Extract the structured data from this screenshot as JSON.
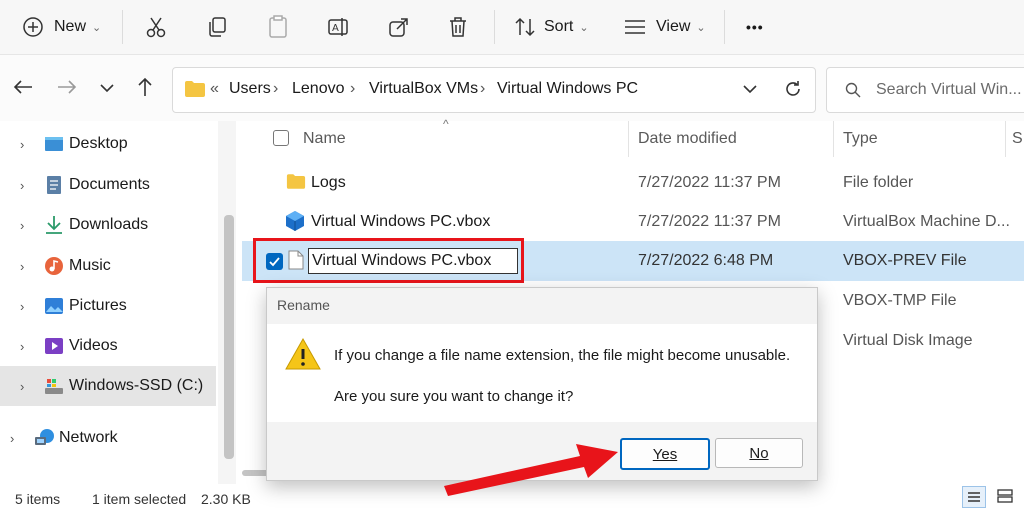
{
  "toolbar": {
    "new_label": "New",
    "sort_label": "Sort",
    "view_label": "View",
    "more_label": "•••",
    "icons": [
      "plus-circle-icon",
      "cut-icon",
      "copy-icon",
      "paste-icon",
      "rename-icon",
      "share-icon",
      "delete-icon",
      "sort-icon",
      "view-icon",
      "more-icon"
    ]
  },
  "nav": {
    "overflow": "«",
    "breadcrumb": [
      "Users",
      "Lenovo",
      "VirtualBox VMs",
      "Virtual Windows PC"
    ],
    "separator": "›",
    "search_placeholder": "Search Virtual Win..."
  },
  "sidebar": {
    "items": [
      {
        "label": "Desktop",
        "icon": "desktop-icon"
      },
      {
        "label": "Documents",
        "icon": "documents-icon"
      },
      {
        "label": "Downloads",
        "icon": "downloads-icon"
      },
      {
        "label": "Music",
        "icon": "music-icon"
      },
      {
        "label": "Pictures",
        "icon": "pictures-icon"
      },
      {
        "label": "Videos",
        "icon": "videos-icon"
      },
      {
        "label": "Windows-SSD (C:)",
        "icon": "drive-icon"
      },
      {
        "label": "Network",
        "icon": "network-icon"
      }
    ]
  },
  "filelist": {
    "columns": {
      "name": "Name",
      "date": "Date modified",
      "type": "Type",
      "size": "S"
    },
    "rows": [
      {
        "name": "Logs",
        "date": "7/27/2022 11:37 PM",
        "type": "File folder",
        "icon": "folder-icon"
      },
      {
        "name": "Virtual Windows PC.vbox",
        "date": "7/27/2022 11:37 PM",
        "type": "VirtualBox Machine D...",
        "icon": "virtualbox-icon"
      },
      {
        "name": "Virtual Windows PC.vbox",
        "date": "7/27/2022 6:48 PM",
        "type": "VBOX-PREV File",
        "icon": "file-icon",
        "selected": true,
        "editing": true
      },
      {
        "name": "",
        "date": "",
        "type": "VBOX-TMP File"
      },
      {
        "name": "",
        "date": "",
        "type": "Virtual Disk Image"
      }
    ]
  },
  "dialog": {
    "title": "Rename",
    "message": "If you change a file name extension, the file might become unusable.",
    "question": "Are you sure you want to change it?",
    "yes_label": "Yes",
    "no_label": "No"
  },
  "status": {
    "items_count": "5 items",
    "selected": "1 item selected",
    "size": "2.30 KB"
  },
  "colors": {
    "accent": "#0067c0",
    "selection": "#cce4f7",
    "annotation_red": "#e8141a",
    "warning_yellow": "#f5c518"
  }
}
